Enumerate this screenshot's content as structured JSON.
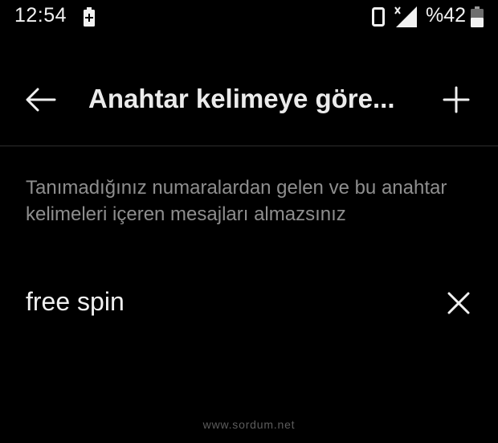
{
  "status_bar": {
    "time": "12:54",
    "battery_percent": "%42",
    "icons": {
      "charge": "battery-charging-icon",
      "phone": "vibrate-phone-icon",
      "signal": "cellular-signal-no-data-icon",
      "battery": "battery-icon"
    }
  },
  "toolbar": {
    "title": "Anahtar kelimeye göre...",
    "back_icon": "arrow-left-icon",
    "add_icon": "plus-icon"
  },
  "description": "Tanımadığınız numaralardan gelen ve bu anahtar kelimeleri içeren mesajları almazsınız",
  "keywords": [
    {
      "text": "free spin",
      "remove_icon": "close-icon"
    }
  ],
  "watermark": "www.sordum.net",
  "colors": {
    "background": "#000000",
    "primary_text": "#ececec",
    "secondary_text": "#8e8e8e",
    "divider": "#2e2e2e"
  }
}
